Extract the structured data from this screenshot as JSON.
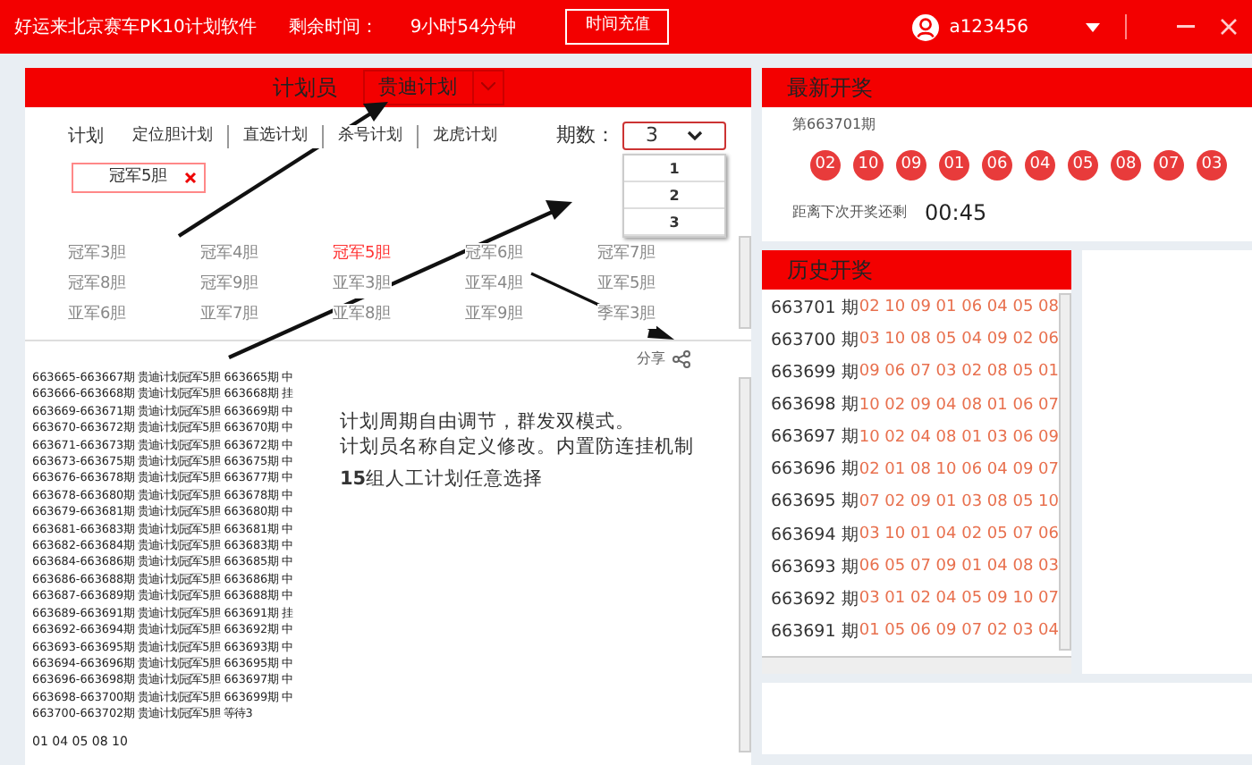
{
  "title_bar": {
    "title": "好运来北京赛车PK10计划软件",
    "remaining_label": "剩余时间：",
    "remaining_value": "9小时54分钟",
    "recharge_button": "时间充值",
    "username": "a123456"
  },
  "planner": {
    "label": "计划员",
    "name": "贵迪计划",
    "plan_label": "计划",
    "plan_tabs": [
      "定位胆计划",
      "直选计划",
      "杀号计划",
      "龙虎计划"
    ],
    "periods_label": "期数：",
    "periods_value": "3",
    "periods_options": [
      "1",
      "2",
      "3"
    ],
    "tag": "冠军5胆",
    "groups": [
      {
        "label": "冠军3胆",
        "selected": false
      },
      {
        "label": "冠军4胆",
        "selected": false
      },
      {
        "label": "冠军5胆",
        "selected": true
      },
      {
        "label": "冠军6胆",
        "selected": false
      },
      {
        "label": "冠军7胆",
        "selected": false
      },
      {
        "label": "冠军8胆",
        "selected": false
      },
      {
        "label": "冠军9胆",
        "selected": false
      },
      {
        "label": "亚军3胆",
        "selected": false
      },
      {
        "label": "亚军4胆",
        "selected": false
      },
      {
        "label": "亚军5胆",
        "selected": false
      },
      {
        "label": "亚军6胆",
        "selected": false
      },
      {
        "label": "亚军7胆",
        "selected": false
      },
      {
        "label": "亚军8胆",
        "selected": false
      },
      {
        "label": "亚军9胆",
        "selected": false
      },
      {
        "label": "季军3胆",
        "selected": false
      }
    ],
    "share": "分享",
    "log": [
      "663665-663667期 贵迪计划冠军5胆 663665期 中",
      "663666-663668期 贵迪计划冠军5胆 663668期 挂",
      "663669-663671期 贵迪计划冠军5胆 663669期 中",
      "663670-663672期 贵迪计划冠军5胆 663670期 中",
      "663671-663673期 贵迪计划冠军5胆 663672期 中",
      "663673-663675期 贵迪计划冠军5胆 663675期 中",
      "663676-663678期 贵迪计划冠军5胆 663677期 中",
      "663678-663680期 贵迪计划冠军5胆 663678期 中",
      "663679-663681期 贵迪计划冠军5胆 663680期 中",
      "663681-663683期 贵迪计划冠军5胆 663681期 中",
      "663682-663684期 贵迪计划冠军5胆 663683期 中",
      "663684-663686期 贵迪计划冠军5胆 663685期 中",
      "663686-663688期 贵迪计划冠军5胆 663686期 中",
      "663687-663689期 贵迪计划冠军5胆 663688期 中",
      "663689-663691期 贵迪计划冠军5胆 663691期 挂",
      "663692-663694期 贵迪计划冠军5胆 663692期 中",
      "663693-663695期 贵迪计划冠军5胆 663693期 中",
      "663694-663696期 贵迪计划冠军5胆 663695期 中",
      "663696-663698期 贵迪计划冠军5胆 663697期 中",
      "663698-663700期 贵迪计划冠军5胆 663699期 中",
      "663700-663702期 贵迪计划冠军5胆 等待3"
    ],
    "numbers": "01 04 05 08 10",
    "notes": [
      "计划周期自由调节，群发双模式。",
      "计划员名称自定义修改。内置防连挂机制",
      "**15**组人工计划任意选择"
    ]
  },
  "latest": {
    "title": "最新开奖",
    "period": "第663701期",
    "balls": [
      "02",
      "10",
      "09",
      "01",
      "06",
      "04",
      "05",
      "08",
      "07",
      "03"
    ],
    "countdown_label": "距离下次开奖还剩",
    "countdown": "00:45"
  },
  "history": {
    "title": "历史开奖",
    "rows": [
      {
        "period": "663701 期",
        "numbers": "02 10 09 01 06 04 05 08"
      },
      {
        "period": "663700 期",
        "numbers": "03 10 08 05 04 09 02 06"
      },
      {
        "period": "663699 期",
        "numbers": "09 06 07 03 02 08 05 01"
      },
      {
        "period": "663698 期",
        "numbers": "10 02 09 04 08 01 06 07"
      },
      {
        "period": "663697 期",
        "numbers": "10 02 04 08 01 03 06 09"
      },
      {
        "period": "663696 期",
        "numbers": "02 01 08 10 06 04 09 07"
      },
      {
        "period": "663695 期",
        "numbers": "07 02 09 01 03 08 05 10"
      },
      {
        "period": "663694 期",
        "numbers": "03 10 01 04 02 05 07 06"
      },
      {
        "period": "663693 期",
        "numbers": "06 05 07 09 01 04 08 03"
      },
      {
        "period": "663692 期",
        "numbers": "03 01 02 04 05 09 10 07"
      },
      {
        "period": "663691 期",
        "numbers": "01 05 06 09 07 02 03 04"
      }
    ]
  }
}
